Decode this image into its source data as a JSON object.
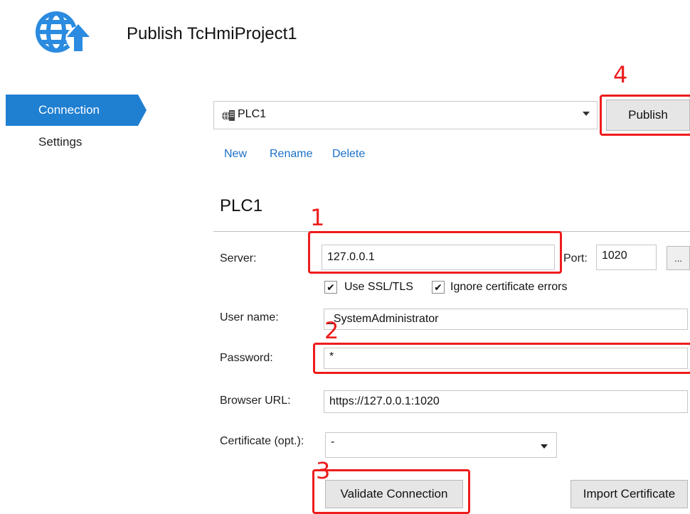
{
  "header": {
    "title": "Publish TcHmiProject1",
    "logo_icon": "globe-upload-icon"
  },
  "sidebar": {
    "items": [
      {
        "label": "Connection",
        "active": true
      },
      {
        "label": "Settings",
        "active": false
      }
    ]
  },
  "profile": {
    "selected": "PLC1",
    "icon": "server-icon"
  },
  "toolbar": {
    "publish_label": "Publish"
  },
  "profile_actions": {
    "new": "New",
    "rename": "Rename",
    "delete": "Delete"
  },
  "section": {
    "title": "PLC1"
  },
  "form": {
    "server": {
      "label": "Server:",
      "value": "127.0.0.1"
    },
    "port": {
      "label": "Port:",
      "value": "1020"
    },
    "more_label": "...",
    "use_ssl": {
      "label": "Use SSL/TLS",
      "checked": true
    },
    "ignore_cert": {
      "label": "Ignore certificate errors",
      "checked": true
    },
    "check_mark": "✔",
    "username": {
      "label": "User name:",
      "value": "_SystemAdministrator"
    },
    "password": {
      "label": "Password:",
      "value": "*"
    },
    "browser_url": {
      "label": "Browser URL:",
      "value": "https://127.0.0.1:1020"
    },
    "certificate": {
      "label": "Certificate (opt.):",
      "value": "-"
    }
  },
  "buttons": {
    "validate": "Validate Connection",
    "import_cert": "Import Certificate"
  },
  "annotations": {
    "n1": "1",
    "n2": "2",
    "n3": "3",
    "n4": "4"
  },
  "colors": {
    "accent": "#1f7fd1",
    "annotation": "#ee1c1c",
    "link": "#1a6fc7"
  }
}
